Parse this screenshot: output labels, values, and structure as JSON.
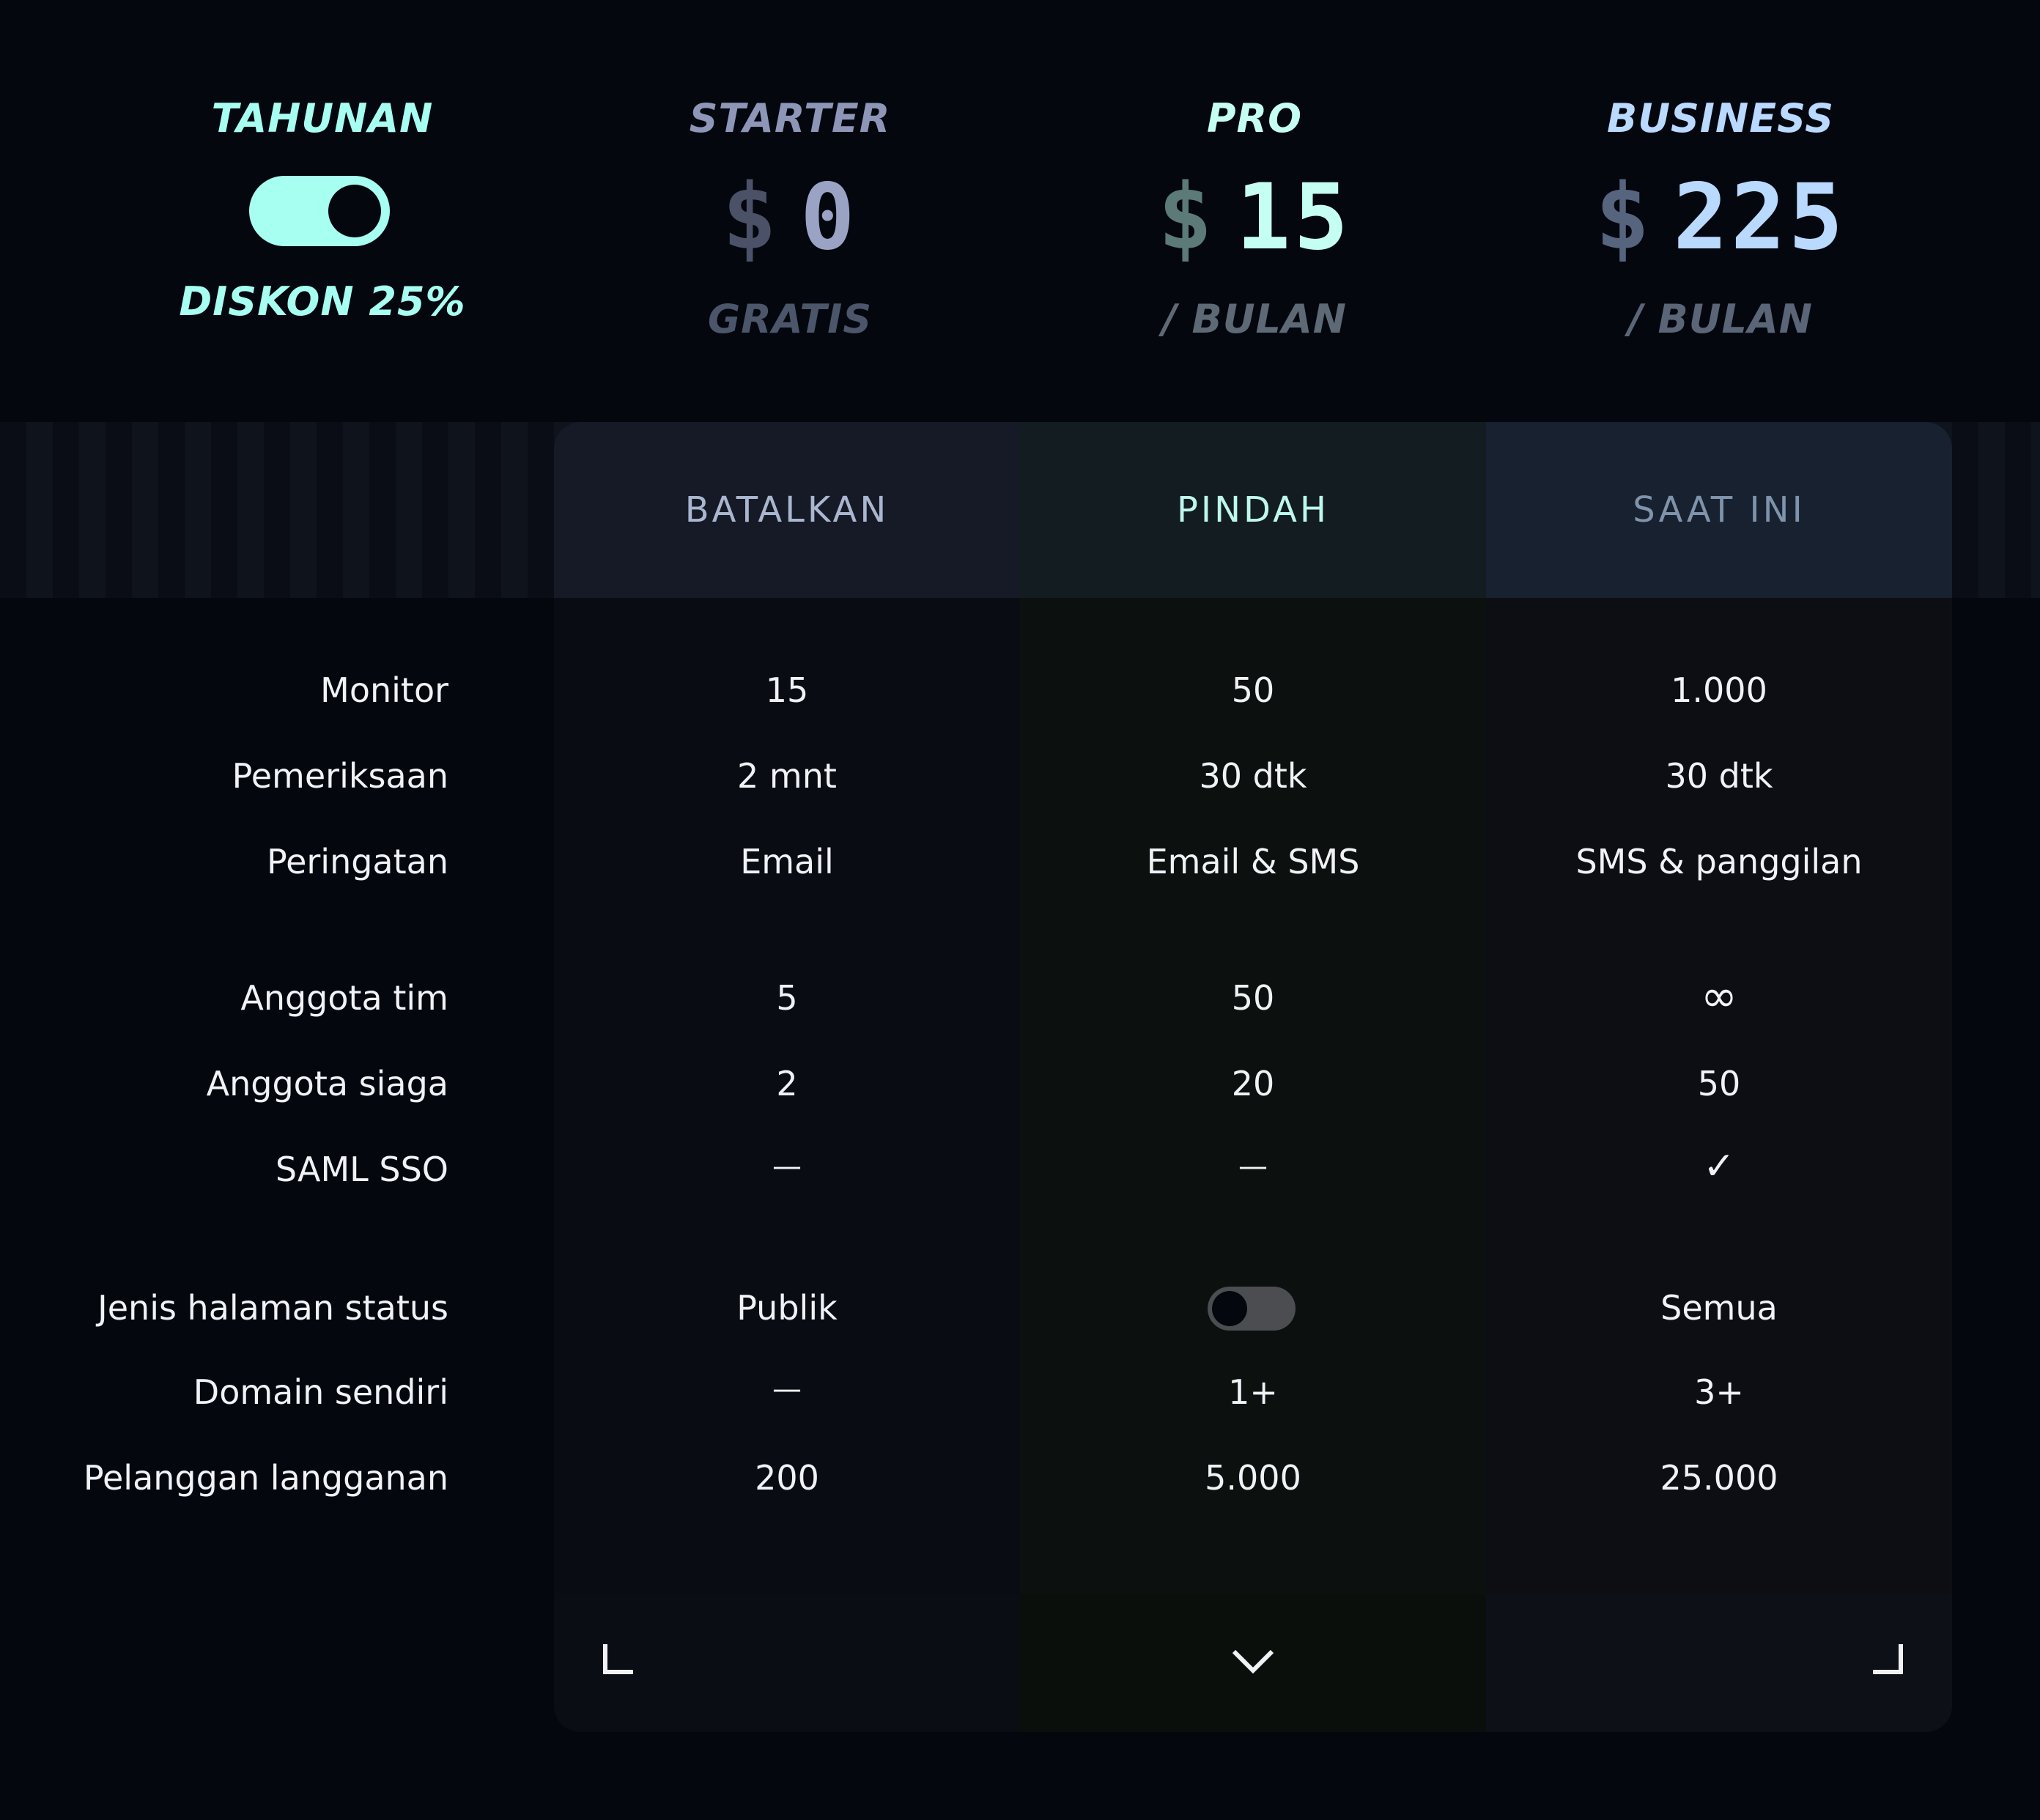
{
  "billing": {
    "period_label": "TAHUNAN",
    "discount_label": "DISKON 25%",
    "annual_toggle_on": true
  },
  "plans": [
    {
      "name": "STARTER",
      "currency": "$",
      "price": "0",
      "period": "GRATIS",
      "action": "BATALKAN"
    },
    {
      "name": "PRO",
      "currency": "$",
      "price": "15",
      "period": "/ BULAN",
      "action": "PINDAH"
    },
    {
      "name": "BUSINESS",
      "currency": "$",
      "price": "225",
      "period": "/ BULAN",
      "action": "SAAT INI"
    }
  ],
  "features": {
    "monitors": {
      "label": "Monitor",
      "values": [
        "15",
        "50",
        "1.000"
      ]
    },
    "checks": {
      "label": "Pemeriksaan",
      "values": [
        "2 mnt",
        "30 dtk",
        "30 dtk"
      ]
    },
    "alerts": {
      "label": "Peringatan",
      "values": [
        "Email",
        "Email & SMS",
        "SMS & panggilan"
      ]
    },
    "team_members": {
      "label": "Anggota tim",
      "values": [
        "5",
        "50",
        "∞"
      ]
    },
    "on_call": {
      "label": "Anggota siaga",
      "values": [
        "2",
        "20",
        "50"
      ]
    },
    "saml_sso": {
      "label": "SAML SSO",
      "values": [
        "—",
        "—",
        "✓"
      ]
    },
    "status_page": {
      "label": "Jenis halaman status",
      "values": [
        "Publik",
        "",
        "Semua"
      ],
      "pro_toggle_on": false
    },
    "custom_domain": {
      "label": "Domain sendiri",
      "values": [
        "—",
        "1+",
        "3+"
      ]
    },
    "subscribers": {
      "label": "Pelanggan langganan",
      "values": [
        "200",
        "5.000",
        "25.000"
      ]
    }
  },
  "colors": {
    "background": "#05070f",
    "accent": "#a7fff2",
    "starter_price": "#9aa3c4",
    "pro_price": "#c5fff4",
    "business_price": "#b9d9ff"
  },
  "icons": {
    "footer_left": "corner-bracket-left-icon",
    "footer_center": "chevron-down-icon",
    "footer_right": "corner-bracket-right-icon"
  }
}
